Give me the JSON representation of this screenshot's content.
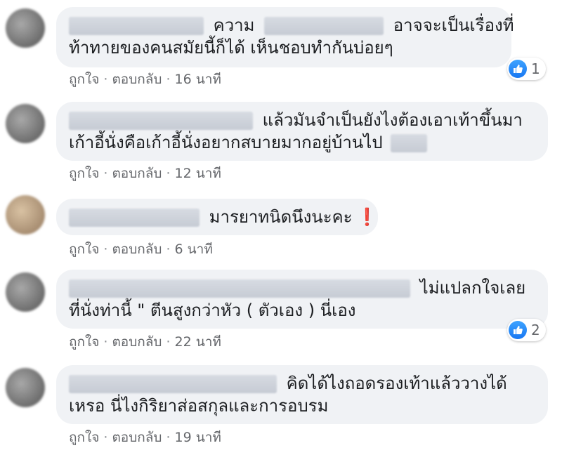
{
  "actions": {
    "like": "ถูกใจ",
    "reply": "ตอบกลับ",
    "separator": "·"
  },
  "comments": [
    {
      "text_part1": "ความ",
      "text_part2": "อาจจะเป็นเรื่องที่",
      "text_line2": "ท้าทายของคนสมัยนี้ก็ได้ เห็นชอบทำกันบ่อยๆ",
      "time": "16 นาที",
      "reactions": {
        "icon": "like-icon",
        "count": "1"
      }
    },
    {
      "text_line1": "แล้วมันจำเป็นยังไงต้องเอาเท้าขึ้นมา",
      "text_line2": "เก้าอี้นั่งคือเก้าอี้นั่งอยากสบายมากอยู่บ้านไป",
      "time": "12 นาที"
    },
    {
      "text_line1": "มารยาทนิดนึงนะคะ",
      "emoji": "❗",
      "time": "6 นาที"
    },
    {
      "text_line1": "ไม่แปลกใจเลย",
      "text_line2": "ที่นั่งท่านี้ \" ตีนสูงกว่าหัว ( ตัวเอง ) นี่เอง",
      "time": "22 นาที",
      "reactions": {
        "icon": "like-icon",
        "count": "2"
      }
    },
    {
      "text_line1": "คิดได้ไงถอดรองเท้าแล้ววางได้",
      "text_line2": "เหรอ นี่ไงกิริยาส่อสกุลและการอบรม",
      "time": "19 นาที"
    }
  ],
  "colors": {
    "bubble": "#f0f2f5",
    "meta_text": "#65676b",
    "like_blue": "#1877f2",
    "exclamation_red": "#e0245e"
  }
}
